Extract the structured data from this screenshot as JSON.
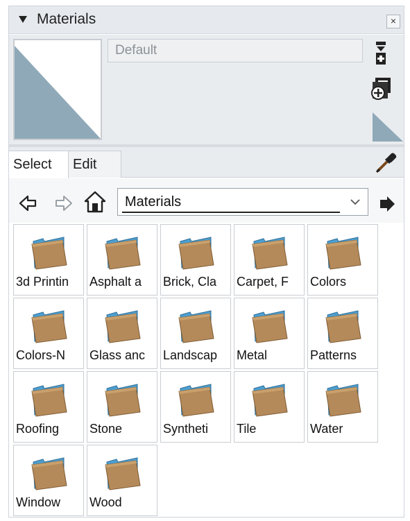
{
  "panel": {
    "title": "Materials",
    "close_label": "×"
  },
  "material": {
    "name": "Default",
    "swatch_color": "#8fa9b8"
  },
  "tabs": [
    {
      "label": "Select",
      "active": true
    },
    {
      "label": "Edit",
      "active": false
    }
  ],
  "nav": {
    "collection": "Materials"
  },
  "folders": [
    {
      "label": "3d Printin"
    },
    {
      "label": "Asphalt a"
    },
    {
      "label": "Brick, Cla"
    },
    {
      "label": "Carpet, F"
    },
    {
      "label": "Colors"
    },
    {
      "label": "Colors-N"
    },
    {
      "label": "Glass anc"
    },
    {
      "label": "Landscap"
    },
    {
      "label": "Metal"
    },
    {
      "label": "Patterns"
    },
    {
      "label": "Roofing"
    },
    {
      "label": "Stone"
    },
    {
      "label": "Syntheti"
    },
    {
      "label": "Tile"
    },
    {
      "label": "Water"
    },
    {
      "label": "Window"
    },
    {
      "label": "Wood"
    }
  ],
  "icons": {
    "collapse": "triangle-down-icon",
    "close": "close-icon",
    "display_secondary": "secondary-pane-icon",
    "create_material": "create-material-icon",
    "sample_paint": "eyedropper-icon",
    "back": "back-arrow-icon",
    "forward": "forward-arrow-icon",
    "home": "home-icon",
    "details": "details-arrow-icon",
    "folder": "folder-icon"
  },
  "colors": {
    "folder_back": "#4d9fd1",
    "folder_front": "#b58a5a",
    "swatch": "#8fa9b8"
  }
}
